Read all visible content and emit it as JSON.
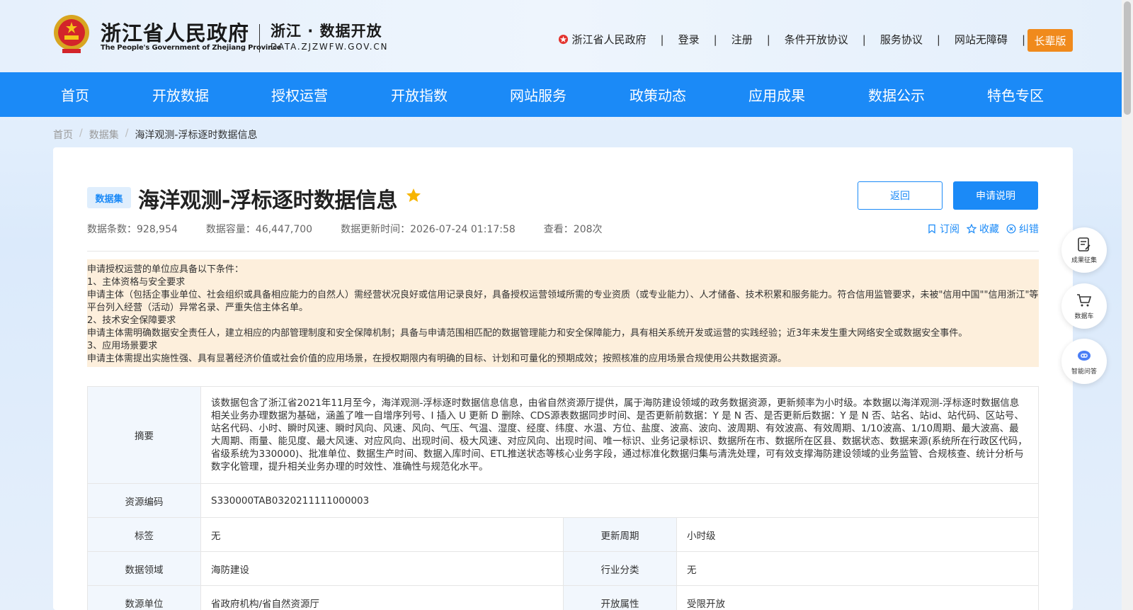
{
  "header": {
    "gov_name_cn": "浙江省人民政府",
    "gov_name_en": "The People's Government of Zhejiang Province",
    "site_name_cn": "浙江 · 数据开放",
    "site_domain": "DATA.ZJZWFW.GOV.CN",
    "links": [
      "浙江省人民政府",
      "登录",
      "注册",
      "条件开放协议",
      "服务协议",
      "网站无障碍"
    ],
    "separator": "|",
    "elder_mode": "长辈版"
  },
  "nav": {
    "items": [
      "首页",
      "开放数据",
      "授权运营",
      "开放指数",
      "网站服务",
      "政策动态",
      "应用成果",
      "数据公示",
      "特色专区"
    ]
  },
  "breadcrumb": {
    "items": [
      "首页",
      "数据集",
      "海洋观测-浮标逐时数据信息"
    ],
    "separator": "/"
  },
  "dataset": {
    "type_tag": "数据集",
    "title": "海洋观测-浮标逐时数据信息",
    "back_label": "返回",
    "apply_label": "申请说明",
    "stats": {
      "count": "数据条数：928,954",
      "size": "数据容量：46,447,700",
      "updated": "数据更新时间：2026-07-24 01:17:58",
      "views": "查看：208次"
    },
    "actions": {
      "subscribe": "订阅",
      "favorite": "收藏",
      "correct": "纠错"
    },
    "notice": [
      "申请授权运营的单位应具备以下条件：",
      "1、主体资格与安全要求",
      "申请主体（包括企事业单位、社会组织或具备相应能力的自然人）需经营状况良好或信用记录良好，具备授权运营领域所需的专业资质（或专业能力）、人才储备、技术积累和服务能力。符合信用监管要求，未被\"信用中国\"\"信用浙江\"等平台列入经营（活动）异常名录、严重失信主体名单。",
      "2、技术安全保障要求",
      "申请主体需明确数据安全责任人，建立相应的内部管理制度和安全保障机制；具备与申请范围相匹配的数据管理能力和安全保障能力，具有相关系统开发或运营的实践经验；近3年未发生重大网络安全或数据安全事件。",
      "3、应用场景要求",
      "申请主体需提出实施性强、具有显著经济价值或社会价值的应用场景，在授权期限内有明确的目标、计划和可量化的预期成效；按照核准的应用场景合规使用公共数据资源。"
    ],
    "table": {
      "abstract_label": "摘要",
      "abstract": "该数据包含了浙江省2021年11月至今，海洋观测-浮标逐时数据信息信息，由省自然资源厅提供，属于海防建设领域的政务数据资源，更新频率为小时级。本数据以海洋观测-浮标逐时数据信息相关业务办理数据为基础，涵盖了唯一自增序列号、I 插入 U 更新 D 删除、CDS源表数据同步时间、是否更新前数据：Y 是 N 否、是否更新后数据：Y 是 N 否、站名、站id、站代码、区站号、站名代码、小时、瞬时风速、瞬时风向、风速、风向、气压、气温、湿度、经度、纬度、水温、方位、盐度、波高、波向、波周期、有效波高、有效周期、1/10波高、1/10周期、最大波高、最大周期、雨量、能见度、最大风速、对应风向、出现时间、极大风速、对应风向、出现时间、唯一标识、业务记录标识、数据所在市、数据所在区县、数据状态、数据来源(系统所在行政区代码，省级系统为330000)、批准单位、数据生产时间、数据入库时间、ETL推送状态等核心业务字段，通过标准化数据归集与清洗处理，可有效支撑海防建设领域的业务监管、合规核查、统计分析与数字化管理，提升相关业务办理的时效性、准确性与规范化水平。",
      "code_label": "资源编码",
      "code": "S330000TAB0320211111000003",
      "tag_label": "标签",
      "tag": "无",
      "cycle_label": "更新周期",
      "cycle": "小时级",
      "domain_label": "数据领域",
      "domain": "海防建设",
      "industry_label": "行业分类",
      "industry": "无",
      "unit_label": "数源单位",
      "unit": "省政府机构/省自然资源厅",
      "open_label": "开放属性",
      "open": "受限开放"
    }
  },
  "float_tools": [
    "成果征集",
    "数据车",
    "智能问答"
  ],
  "colors": {
    "primary": "#1b8af7",
    "elder": "#f08a1c",
    "notice_bg": "#fdefdc",
    "label_bg": "#f2f7fd",
    "star": "#f7b500"
  }
}
